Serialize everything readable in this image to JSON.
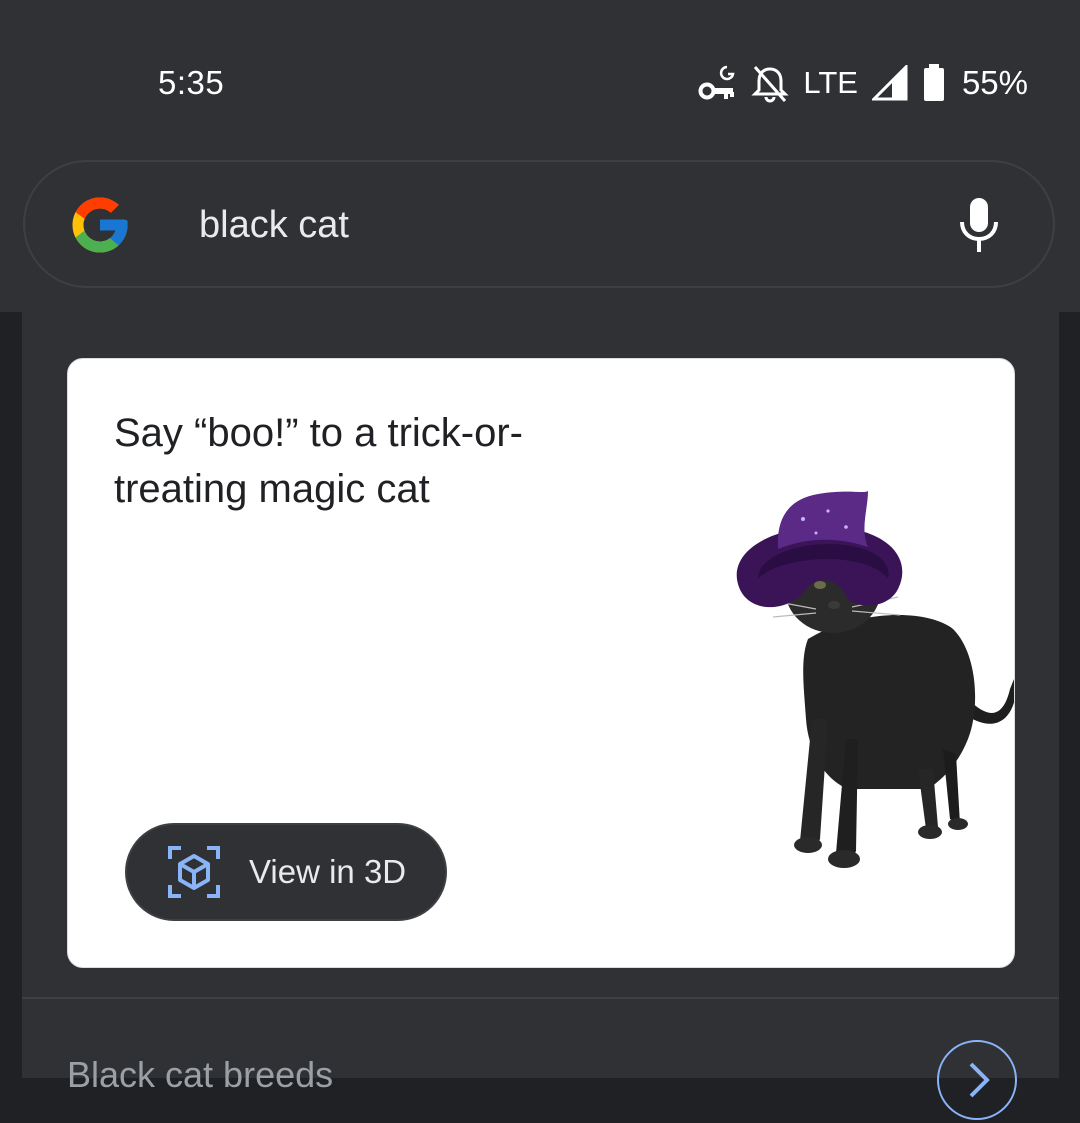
{
  "status_bar": {
    "time": "5:35",
    "network": "LTE",
    "battery": "55%",
    "icons": [
      "vpn-key-icon",
      "notifications-off-icon",
      "signal-icon",
      "battery-icon"
    ]
  },
  "search": {
    "query": "black cat",
    "icons": [
      "google-logo",
      "mic-icon"
    ]
  },
  "card": {
    "title": "Say “boo!” to a trick-or-treating magic cat",
    "button_label": "View in 3D",
    "button_icon": "view-in-3d-icon"
  },
  "next_row": {
    "label": "Black cat breeds",
    "icon": "chevron-right-icon"
  },
  "colors": {
    "surface": "#303134",
    "background": "#202124",
    "accent": "#8ab4f8",
    "text": "#e8eaed"
  }
}
